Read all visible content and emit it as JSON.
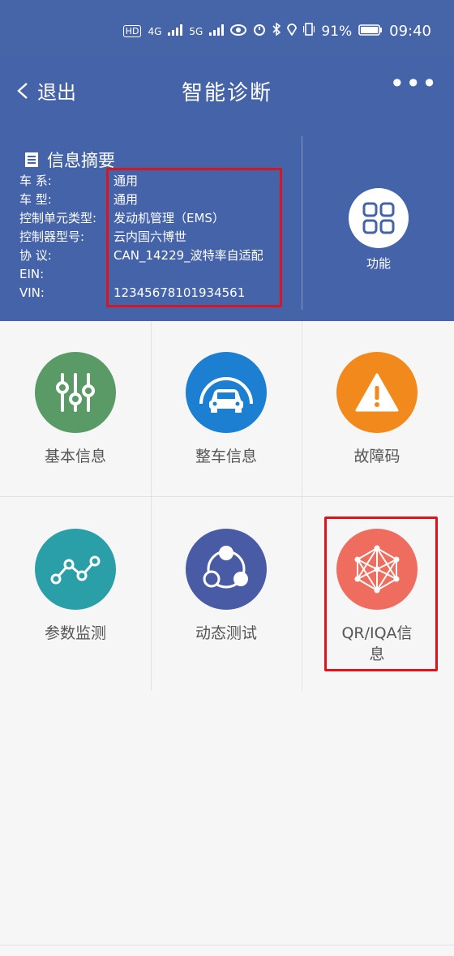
{
  "status_bar": {
    "signal_1": "4G",
    "signal_2": "5G",
    "battery_percent": "91%",
    "time": "09:40"
  },
  "header": {
    "back_label": "退出",
    "title": "智能诊断",
    "more_label": "•••"
  },
  "summary": {
    "title": "信息摘要",
    "rows": [
      {
        "label": "车 系:",
        "value": "通用"
      },
      {
        "label": "车 型:",
        "value": "通用"
      },
      {
        "label": "控制单元类型:",
        "value": "发动机管理（EMS）"
      },
      {
        "label": "控制器型号:",
        "value": "云内国六博世"
      },
      {
        "label": "协 议:",
        "value": "CAN_14229_波特率自适配"
      },
      {
        "label": "EIN:",
        "value": ""
      },
      {
        "label": "VIN:",
        "value": "12345678101934561"
      }
    ],
    "function_label": "功能"
  },
  "grid": {
    "items": [
      {
        "label": "基本信息",
        "icon": "sliders-icon",
        "color": "#5a9a66"
      },
      {
        "label": "整车信息",
        "icon": "car-icon",
        "color": "#1d7fd1"
      },
      {
        "label": "故障码",
        "icon": "warning-icon",
        "color": "#f2891d"
      },
      {
        "label": "参数监测",
        "icon": "line-chart-icon",
        "color": "#2b9fa8"
      },
      {
        "label": "动态测试",
        "icon": "share-nodes-icon",
        "color": "#4a5ba6"
      },
      {
        "label": "QR/IQA信\n息",
        "label_line1": "QR/IQA信",
        "label_line2": "息",
        "icon": "network-icon",
        "color": "#ef6d5e"
      }
    ]
  },
  "colors": {
    "header_bg": "#4563a8",
    "highlight": "#e0121a"
  }
}
